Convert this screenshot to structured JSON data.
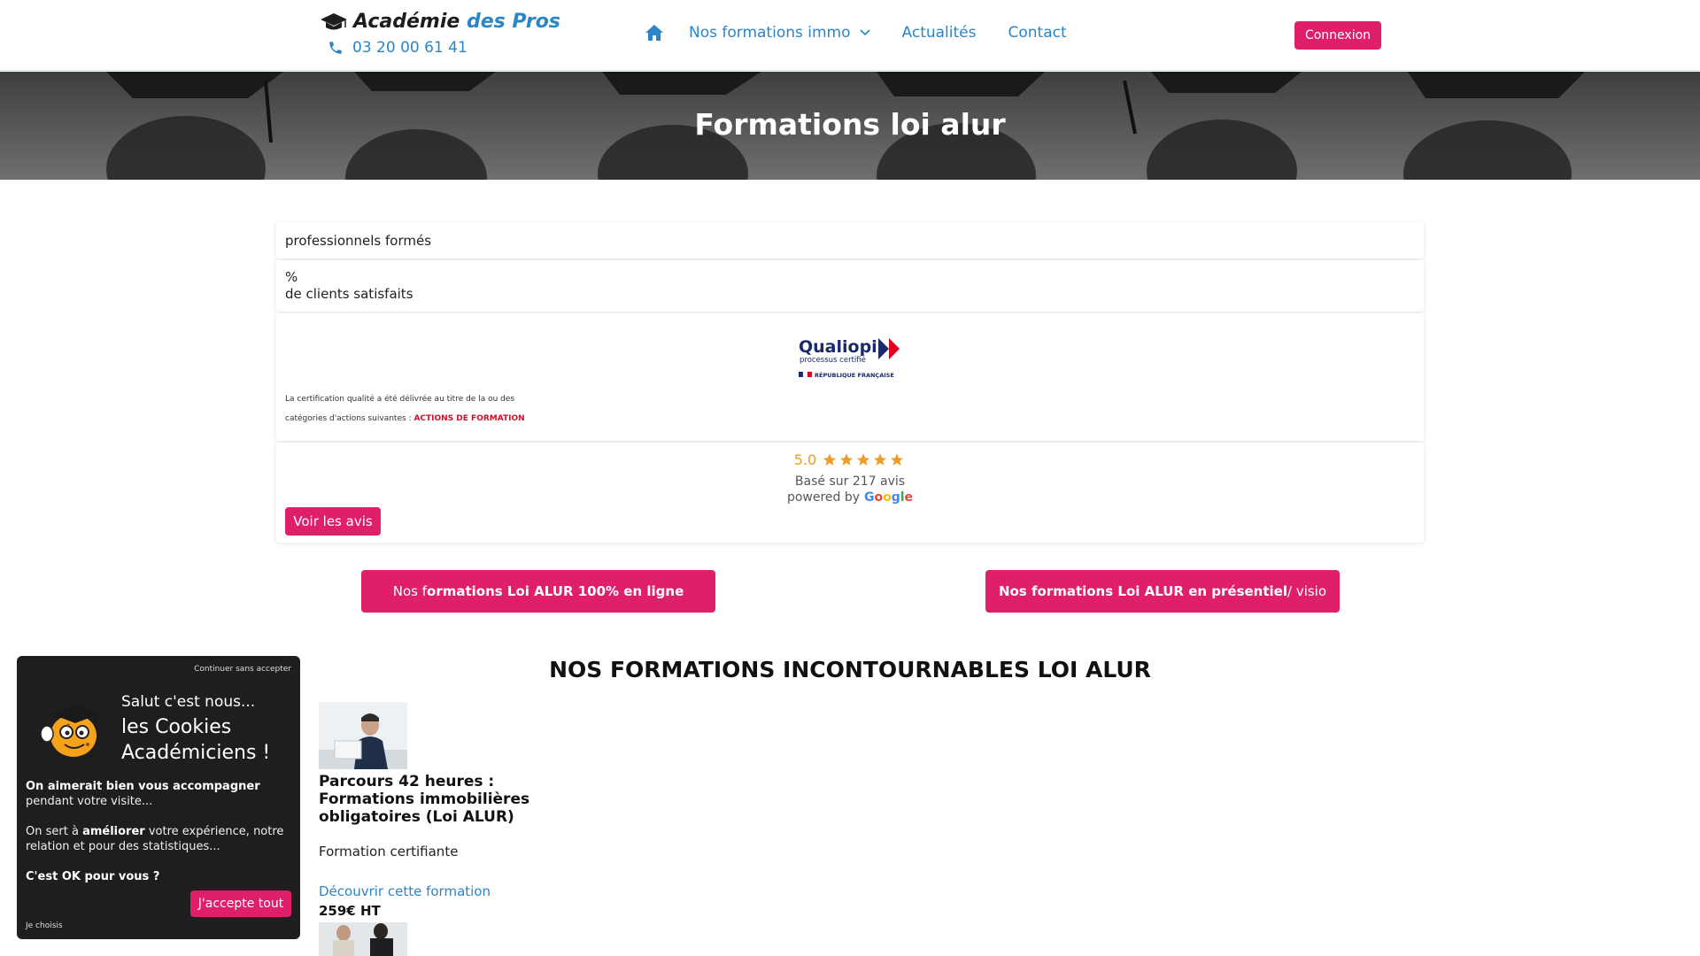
{
  "header": {
    "logo_part1": "Académie",
    "logo_part2": "des Pros",
    "phone": "03 20 00 61 41",
    "nav": [
      {
        "label": "Nos formations immo"
      },
      {
        "label": "Actualités"
      },
      {
        "label": "Contact"
      }
    ],
    "login_label": "Connexion",
    "icons": {
      "logo": "graduation-cap-icon",
      "phone": "phone-icon",
      "home": "home-icon",
      "dropdown": "chevron-down-icon"
    }
  },
  "hero": {
    "title": "Formations loi alur"
  },
  "stats": {
    "trained_label": "professionnels formés",
    "percent_symbol": "%",
    "satisfied_label": "de clients satisfaits"
  },
  "certification": {
    "logo_name": "Qualiopi",
    "logo_sub": "processus certifié",
    "logo_country": "RÉPUBLIQUE FRANÇAISE",
    "line1": "La certification qualité a été délivrée au titre de la ou des",
    "line2_prefix": "catégories d'actions suivantes : ",
    "line2_highlight": "ACTIONS DE FORMATION"
  },
  "reviews": {
    "rating": "5.0",
    "stars": 5,
    "based_on": "Basé sur 217 avis",
    "powered_by": "powered by",
    "provider": [
      "G",
      "o",
      "o",
      "g",
      "l",
      "e"
    ],
    "button_label": "Voir les avis"
  },
  "cta": {
    "online": {
      "prefix": "Nos f",
      "bold": "ormations Loi ALUR 100% en ligne",
      "icon": "chevron-right-icon"
    },
    "presential": {
      "bold": "Nos formations Loi ALUR en présentiel",
      "suffix": " / visio",
      "icon": "chevron-right-icon"
    }
  },
  "section": {
    "title": "NOS FORMATIONS INCONTOURNABLES LOI ALUR"
  },
  "formations": [
    {
      "title": "Parcours 42 heures : Formations immobilières obligatoires (Loi ALUR)",
      "subtitle": "Formation certifiante",
      "link": "Découvrir cette formation",
      "price": "259€ HT"
    }
  ],
  "cookie": {
    "skip": "Continuer sans accepter",
    "hello": "Salut c'est nous...",
    "big_line1": "les Cookies",
    "big_line2": "Académiciens !",
    "p1_bold": "On aimerait bien vous accompagner",
    "p1_rest": " pendant votre visite...",
    "p2_prefix": "On sert à ",
    "p2_bold": "améliorer",
    "p2_rest": " votre expérience, notre relation et pour des statistiques...",
    "question": "C'est OK pour vous ?",
    "accept": "J'accepte tout",
    "choose": "Je choisis"
  },
  "colors": {
    "brand_blue": "#2b86c5",
    "brand_pink": "#e01f6a",
    "star_orange": "#f09a28"
  }
}
